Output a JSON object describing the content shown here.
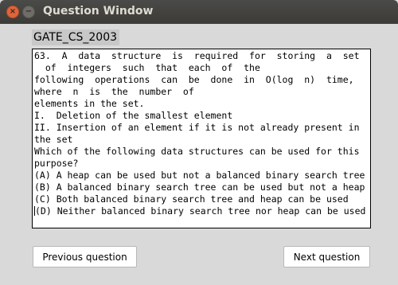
{
  "window": {
    "title": "Question Window",
    "close_glyph": "×",
    "minimize_glyph": "−"
  },
  "exam_label": "GATE_CS_2003",
  "question_lines": [
    "63.  A  data  structure  is  required  for  storing  a  set",
    "  of  integers  such  that  each  of  the",
    "following  operations  can  be  done  in  O(log  n)  time,",
    "where  n  is  the  number  of",
    "elements in the set.",
    "I.  Deletion of the smallest element",
    "II. Insertion of an element if it is not already present in",
    "the set",
    "Which of the following data structures can be used for this",
    "purpose?",
    "(A) A heap can be used but not a balanced binary search tree",
    "(B) A balanced binary search tree can be used but not a heap",
    "(C) Both balanced binary search tree and heap can be used",
    "(D) Neither balanced binary search tree nor heap can be used"
  ],
  "buttons": {
    "previous": "Previous question",
    "next": "Next question"
  }
}
